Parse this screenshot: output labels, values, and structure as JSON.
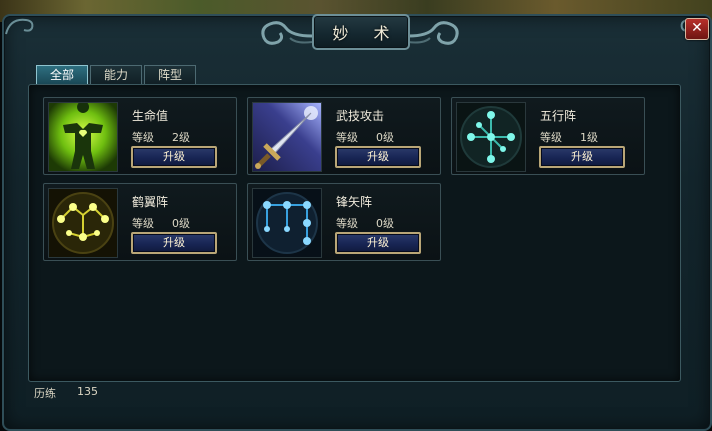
{
  "window": {
    "title": "妙 术",
    "close_label": "✕"
  },
  "tabs": [
    {
      "label": "全部",
      "active": true
    },
    {
      "label": "能力",
      "active": false
    },
    {
      "label": "阵型",
      "active": false
    }
  ],
  "skills": [
    {
      "name": "生命值",
      "level_label": "等级",
      "level": "2级",
      "button": "升级",
      "icon": "green-warrior-heart-icon"
    },
    {
      "name": "武技攻击",
      "level_label": "等级",
      "level": "0级",
      "button": "升级",
      "icon": "sword-icon"
    },
    {
      "name": "五行阵",
      "level_label": "等级",
      "level": "1级",
      "button": "升级",
      "icon": "cyan-formation-icon"
    },
    {
      "name": "鹤翼阵",
      "level_label": "等级",
      "level": "0级",
      "button": "升级",
      "icon": "yellow-formation-icon"
    },
    {
      "name": "锋矢阵",
      "level_label": "等级",
      "level": "0级",
      "button": "升级",
      "icon": "blue-formation-icon"
    }
  ],
  "footer": {
    "label": "历练",
    "value": "135"
  },
  "colors": {
    "accent_tab": "#2e6f80",
    "button_border": "#b9a677",
    "close": "#b8302a"
  }
}
